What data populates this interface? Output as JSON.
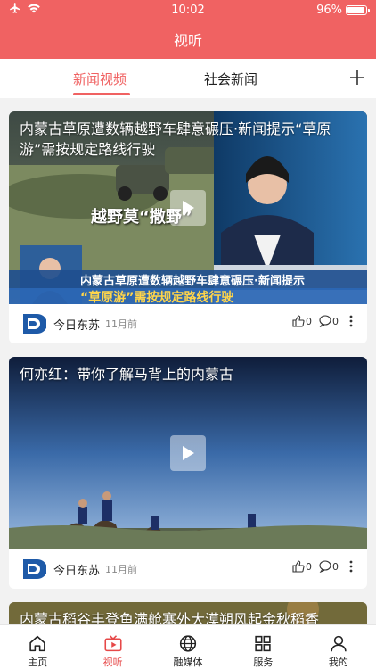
{
  "status": {
    "time": "10:02",
    "battery": "96%",
    "battery_level": 0.96
  },
  "header": {
    "title": "视听"
  },
  "tabs": [
    {
      "label": "新闻视频"
    },
    {
      "label": "社会新闻"
    }
  ],
  "feed": [
    {
      "title": "内蒙古草原遭数辆越野车肆意碾压·新闻提示“草原游”需按规定路线行驶",
      "caption": "内蒙古草原遭数辆越野车肆意碾压·新闻提示",
      "caption2": "“草原游”需按规定路线行驶",
      "overlay_text": "越野莫“撒野”",
      "source": "今日东苏",
      "time": "11月前",
      "likes": "0",
      "comments": "0"
    },
    {
      "title": "何亦红：带你了解马背上的内蒙古",
      "source": "今日东苏",
      "time": "11月前",
      "likes": "0",
      "comments": "0"
    },
    {
      "title": "内蒙古稻谷丰登鱼满舱塞外大漠朔风起金秋稻香"
    }
  ],
  "tabbar": [
    {
      "label": "主页"
    },
    {
      "label": "视听"
    },
    {
      "label": "融媒体"
    },
    {
      "label": "服务"
    },
    {
      "label": "我的"
    }
  ],
  "colors": {
    "accent": "#f06262",
    "active_tab": "#e64848"
  }
}
